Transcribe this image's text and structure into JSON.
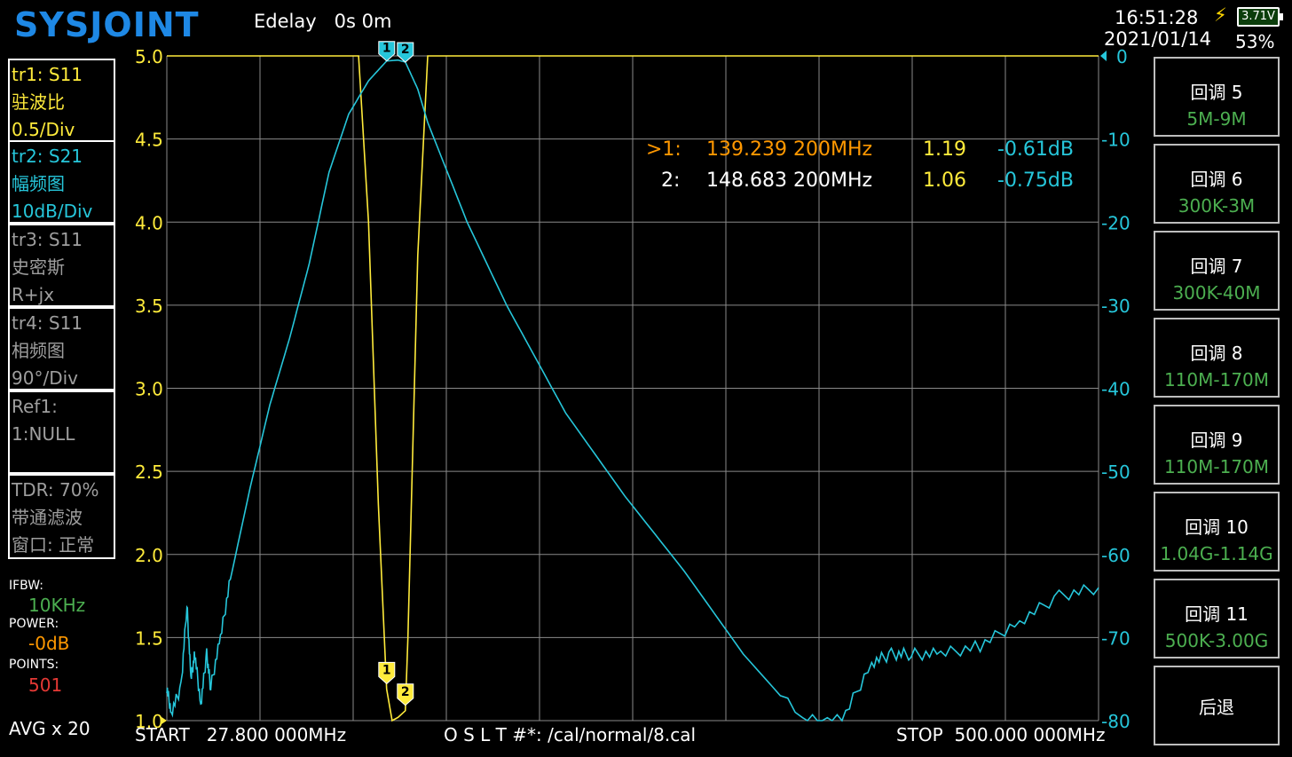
{
  "header": {
    "logo": "SYSJOINT",
    "edelay_label": "Edelay",
    "edelay_value": "0s 0m",
    "time": "16:51:28",
    "date": "2021/01/14",
    "battery_voltage": "3.71V",
    "battery_percent": "53%",
    "charging_icon": "lightning-bolt-icon"
  },
  "traces": [
    {
      "line1": "tr1:   S11",
      "line2": "驻波比",
      "line3": "0.5/Div",
      "color": "#ffeb3b"
    },
    {
      "line1": "tr2:   S21",
      "line2": "幅频图",
      "line3": "10dB/Div",
      "color": "#26c6da"
    },
    {
      "line1": "tr3:   S11",
      "line2": "史密斯",
      "line3": "R+jx",
      "color": "#9e9e9e"
    },
    {
      "line1": "tr4:   S11",
      "line2": "相频图",
      "line3": "90°/Div",
      "color": "#9e9e9e"
    },
    {
      "line1": "Ref1:",
      "line2": "1:NULL",
      "line3": "",
      "color": "#9e9e9e"
    },
    {
      "line1": "TDR: 70%",
      "line2": "带通滤波",
      "line3": "窗口: 正常",
      "color": "#9e9e9e"
    }
  ],
  "settings": {
    "ifbw_label": "IFBW:",
    "ifbw_value": "10KHz",
    "power_label": "POWER:",
    "power_value": "-0dB",
    "points_label": "POINTS:",
    "points_value": "501",
    "avg": "AVG x 20"
  },
  "markers": [
    {
      "id": ">1:",
      "freq": "139.239 200MHz",
      "swr": "1.19",
      "db": "-0.61dB",
      "color": "#ff9800"
    },
    {
      "id": "2:",
      "freq": "148.683 200MHz",
      "swr": "1.06",
      "db": "-0.75dB",
      "color": "#ffffff"
    }
  ],
  "footer": {
    "start_label": "START",
    "start_value": "27.800 000MHz",
    "cal_file": "O S L T #*: /cal/normal/8.cal",
    "stop_label": "STOP",
    "stop_value": "500.000 000MHz"
  },
  "buttons": [
    {
      "title": "回调 5",
      "sub": "5M-9M"
    },
    {
      "title": "回调 6",
      "sub": "300K-3M"
    },
    {
      "title": "回调 7",
      "sub": "300K-40M"
    },
    {
      "title": "回调 8",
      "sub": "110M-170M"
    },
    {
      "title": "回调 9",
      "sub": "110M-170M"
    },
    {
      "title": "回调 10",
      "sub": "1.04G-1.14G"
    },
    {
      "title": "回调 11",
      "sub": "500K-3.00G"
    },
    {
      "title": "后退",
      "sub": ""
    }
  ],
  "chart_data": {
    "type": "line",
    "x_range_mhz": [
      27.8,
      500.0
    ],
    "y_left": {
      "label": "SWR",
      "ticks": [
        "5.0",
        "4.5",
        "4.0",
        "3.5",
        "3.0",
        "2.5",
        "2.0",
        "1.5",
        "1.0"
      ],
      "range": [
        1.0,
        5.0
      ],
      "color": "#ffeb3b"
    },
    "y_right": {
      "label": "dB",
      "ticks": [
        "0",
        "-10",
        "-20",
        "-30",
        "-40",
        "-50",
        "-60",
        "-70",
        "-80"
      ],
      "range": [
        -80,
        0
      ],
      "color": "#26c6da"
    },
    "grid": true,
    "series": [
      {
        "name": "tr1 S11 SWR",
        "axis": "left",
        "color": "#ffeb3b",
        "x": [
          27.8,
          100,
          125,
          130,
          135,
          139.2,
          142,
          145,
          148.7,
          150,
          155,
          160,
          161,
          500
        ],
        "y": [
          5.0,
          5.0,
          5.0,
          4.0,
          2.3,
          1.19,
          1.0,
          1.02,
          1.06,
          1.5,
          3.8,
          5.0,
          5.0,
          5.0
        ]
      },
      {
        "name": "tr2 S21 dB",
        "axis": "right",
        "color": "#26c6da",
        "x": [
          27.8,
          30,
          35,
          38,
          40,
          42,
          45,
          48,
          50,
          55,
          60,
          70,
          80,
          90,
          100,
          110,
          120,
          130,
          139.2,
          145,
          148.7,
          155,
          160,
          180,
          200,
          230,
          260,
          290,
          320,
          350,
          370,
          385,
          395,
          405,
          420,
          440,
          460,
          480,
          500
        ],
        "y": [
          -76,
          -79,
          -76,
          -66,
          -75,
          -72,
          -78,
          -72,
          -76,
          -70,
          -63,
          -52,
          -42,
          -34,
          -25,
          -14,
          -7,
          -3,
          -0.61,
          -0.5,
          -0.75,
          -4,
          -8,
          -20,
          -30,
          -43,
          -53,
          -62,
          -72,
          -80,
          -80,
          -73,
          -72,
          -72,
          -72,
          -71,
          -68,
          -65,
          -64
        ]
      }
    ],
    "markers": [
      {
        "id": "1",
        "x": 139.239,
        "swr": 1.19,
        "db": -0.61
      },
      {
        "id": "2",
        "x": 148.683,
        "swr": 1.06,
        "db": -0.75
      }
    ]
  }
}
